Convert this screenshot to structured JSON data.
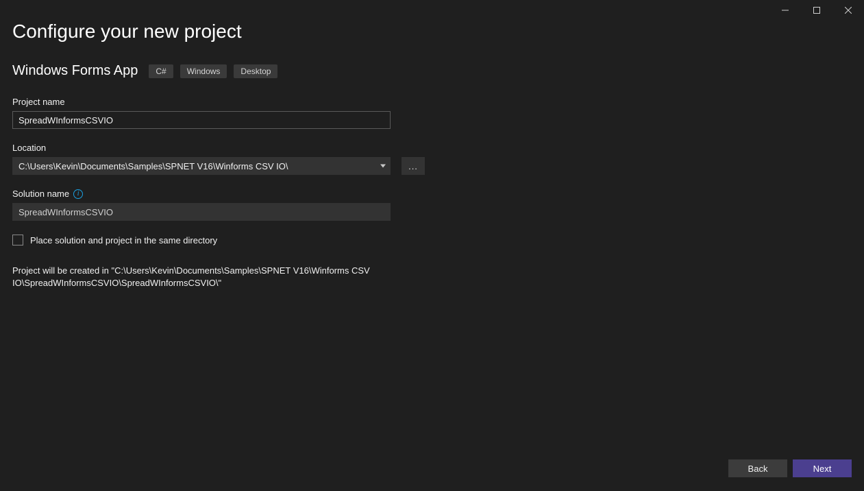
{
  "title": "Configure your new project",
  "subtitle": "Windows Forms App",
  "tags": [
    "C#",
    "Windows",
    "Desktop"
  ],
  "projectName": {
    "label": "Project name",
    "value": "SpreadWInformsCSVIO"
  },
  "location": {
    "label": "Location",
    "value": "C:\\Users\\Kevin\\Documents\\Samples\\SPNET V16\\Winforms CSV IO\\",
    "browse": "..."
  },
  "solutionName": {
    "label": "Solution name",
    "value": "SpreadWInformsCSVIO"
  },
  "placeSameDir": {
    "label": "Place solution and project in the same directory"
  },
  "pathInfo": "Project will be created in \"C:\\Users\\Kevin\\Documents\\Samples\\SPNET V16\\Winforms CSV IO\\SpreadWInformsCSVIO\\SpreadWInformsCSVIO\\\"",
  "buttons": {
    "back": "Back",
    "next": "Next"
  }
}
